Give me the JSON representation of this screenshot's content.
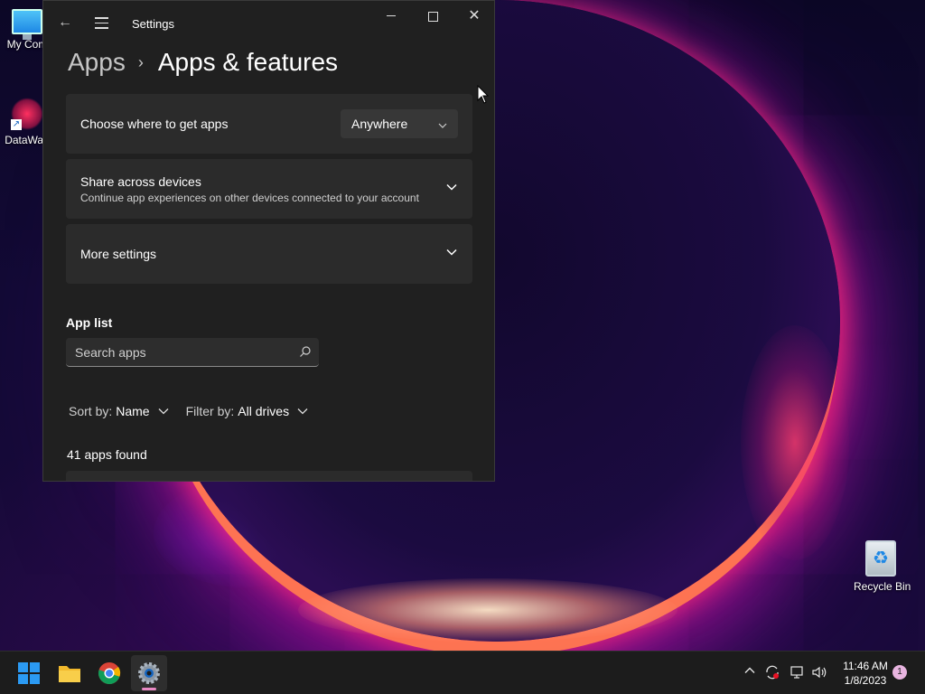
{
  "desktop": {
    "icons": [
      {
        "label": "My Com"
      },
      {
        "label": "DataWag"
      },
      {
        "label": "Recycle Bin"
      }
    ]
  },
  "window": {
    "title": "Settings",
    "breadcrumb": {
      "parent": "Apps",
      "current": "Apps & features"
    },
    "cards": [
      {
        "title": "Choose where to get apps",
        "dropdown_value": "Anywhere"
      },
      {
        "title": "Share across devices",
        "subtitle": "Continue app experiences on other devices connected to your account"
      },
      {
        "title": "More settings"
      }
    ],
    "app_list": {
      "heading": "App list",
      "search_placeholder": "Search apps",
      "sort_label": "Sort by:",
      "sort_value": "Name",
      "filter_label": "Filter by:",
      "filter_value": "All drives",
      "count_text": "41 apps found"
    }
  },
  "taskbar": {
    "time": "11:46 AM",
    "date": "1/8/2023",
    "notification_count": "1"
  },
  "colors": {
    "window_bg": "#202020",
    "card_bg": "#2b2b2b",
    "taskbar_bg": "#1c1c1c",
    "settings_indicator": "#e889c4"
  }
}
